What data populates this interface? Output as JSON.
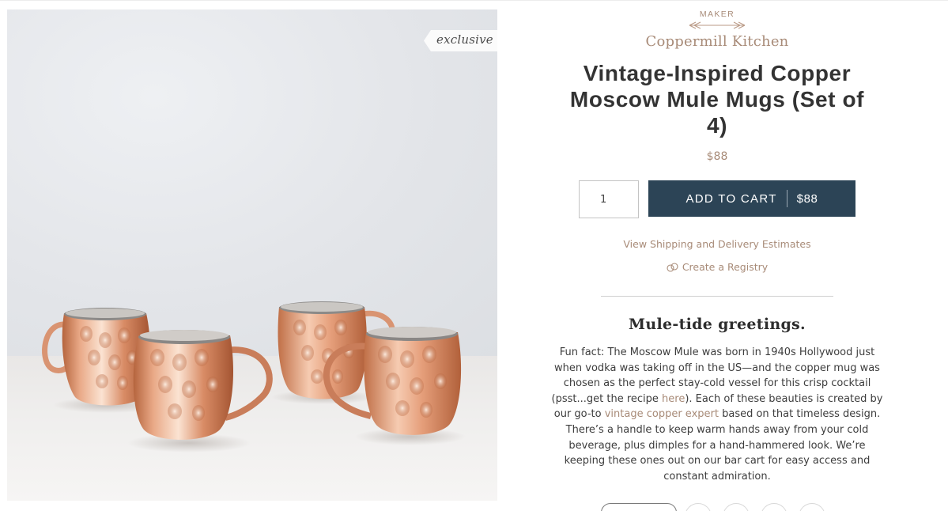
{
  "photo": {
    "badge": "exclusive",
    "alt_subject": "copper-mugs-photo"
  },
  "maker": {
    "label": "MAKER",
    "name": "Coppermill Kitchen"
  },
  "product": {
    "title_line1": "Vintage-Inspired Copper",
    "title_line2": "Moscow Mule Mugs (Set of",
    "title_line3": "4)",
    "price": "$88"
  },
  "cart": {
    "quantity": "1",
    "button_label": "ADD TO CART",
    "button_price": "$88"
  },
  "links": {
    "shipping": "View Shipping and Delivery Estimates",
    "registry": "Create a Registry"
  },
  "story": {
    "headline": "Mule-tide greetings.",
    "text_1": "Fun fact: The Moscow Mule was born in 1940s Hollywood just when vodka was taking off in the US—and the copper mug was chosen as the perfect stay-cold vessel for this crisp cocktail (psst...get the recipe ",
    "link_1": "here",
    "text_2": "). Each of these beauties is created by our go-to ",
    "link_2": "vintage copper expert",
    "text_3": " based on that timeless design. There’s a handle to keep warm hands away from your cold beverage, plus dimples for a hand-hammered look. We’re keeping these ones out on our bar cart for easy access and constant admiration."
  },
  "colors": {
    "accent": "#a88b78",
    "button": "#2c4456",
    "text": "#333333",
    "copper": "#c97d5a"
  }
}
